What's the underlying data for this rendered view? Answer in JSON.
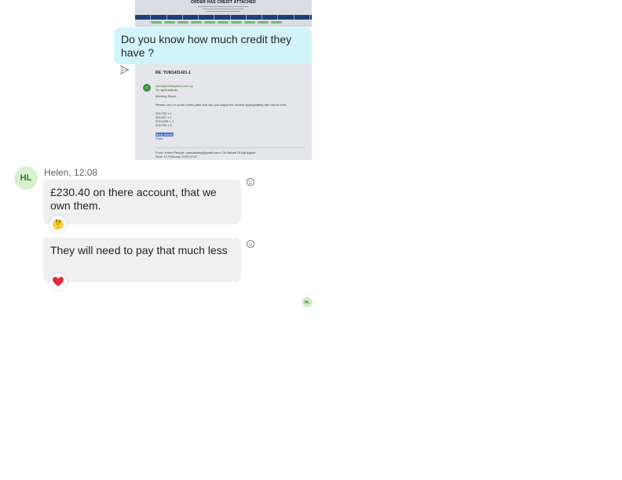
{
  "attachments": {
    "top_image": {
      "banner_title": "ORDER HAS CREDIT ATTACHED"
    },
    "email_image": {
      "subject": "RE: TUM1431421-1",
      "avatar_letter": "c",
      "sender": "chris@chrisleyauto.com.cy",
      "to_line": "To: ayxb.esterto…",
      "greeting": "Morning Steph,",
      "body": "Please can I re-order some parts and can you adjust the invoice appropriately with return here.",
      "lines": [
        "001/702 x 1",
        "001/457 x 1",
        "001/LINE x 4",
        "001/700 x 5"
      ],
      "signoff_highlight": "Many thanks",
      "name": "Chris",
      "from_line": "From: Helen Pescott <sandanitey@gmail.com> On Behalf Of Agt Algent",
      "sent_line": "Sent: 13 February 2025 09:37"
    }
  },
  "messages": {
    "sent_1": {
      "text": "Do you know how much credit they have ?"
    },
    "sender": {
      "initials": "HL",
      "name_time": "Helen, 12:08"
    },
    "received_1": {
      "text": "£230.40 on there account, that we own them.",
      "reaction": "🤔"
    },
    "received_2": {
      "text": "They will need to pay that much less",
      "reaction": "❤️"
    },
    "read_receipt_initials": "HL"
  },
  "colors": {
    "sent_bubble": "#d1f4fa",
    "received_bubble": "#f0f0f0",
    "avatar_bg": "#d7f1cf",
    "avatar_fg": "#2e7a2a",
    "heart": "#e02a3b"
  }
}
